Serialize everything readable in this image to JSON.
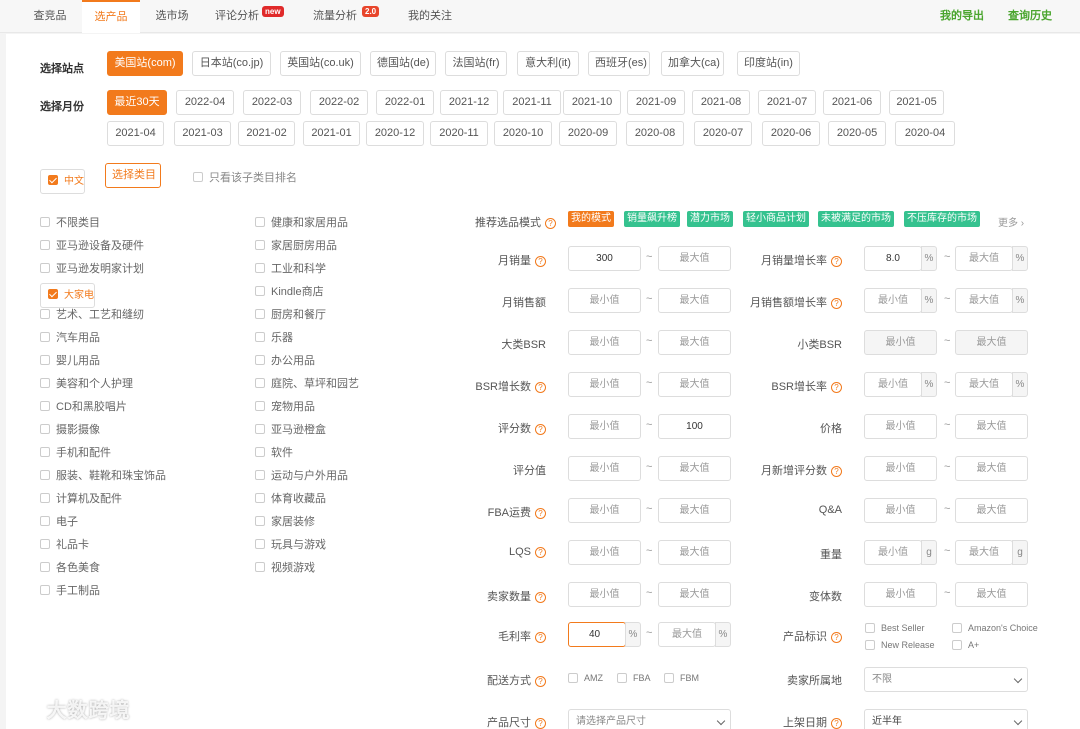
{
  "nav": {
    "tabs": [
      "查竞品",
      "选产品",
      "选市场",
      "评论分析",
      "流量分析",
      "我的关注"
    ],
    "badges": {
      "review": "new",
      "traffic": "2.0"
    },
    "right_links": [
      "我的导出",
      "查询历史"
    ]
  },
  "site": {
    "label": "选择站点",
    "options": [
      "美国站(com)",
      "日本站(co.jp)",
      "英国站(co.uk)",
      "德国站(de)",
      "法国站(fr)",
      "意大利(it)",
      "西班牙(es)",
      "加拿大(ca)",
      "印度站(in)"
    ],
    "selected": "美国站(com)"
  },
  "month": {
    "label": "选择月份",
    "options": [
      "最近30天",
      "2022-04",
      "2022-03",
      "2022-02",
      "2022-01",
      "2021-12",
      "2021-11",
      "2021-10",
      "2021-09",
      "2021-08",
      "2021-07",
      "2021-06",
      "2021-05",
      "2021-04",
      "2021-03",
      "2021-02",
      "2021-01",
      "2020-12",
      "2020-11",
      "2020-10",
      "2020-09",
      "2020-08",
      "2020-07",
      "2020-06",
      "2020-05",
      "2020-04"
    ],
    "selected": "最近30天"
  },
  "lang": {
    "label": "中文",
    "checked": true
  },
  "category_button": "选择类目",
  "only_rank": "只看该子类目排名",
  "categories_left": [
    "不限类目",
    "亚马逊设备及硬件",
    "亚马逊发明家计划",
    "大家电",
    "艺术、工艺和缝纫",
    "汽车用品",
    "婴儿用品",
    "美容和个人护理",
    "CD和黑胶唱片",
    "摄影摄像",
    "手机和配件",
    "服装、鞋靴和珠宝饰品",
    "计算机及配件",
    "电子",
    "礼品卡",
    "各色美食",
    "手工制品"
  ],
  "categories_right": [
    "健康和家居用品",
    "家居厨房用品",
    "工业和科学",
    "Kindle商店",
    "厨房和餐厅",
    "乐器",
    "办公用品",
    "庭院、草坪和园艺",
    "宠物用品",
    "亚马逊橙盒",
    "软件",
    "运动与户外用品",
    "体育收藏品",
    "家居装修",
    "玩具与游戏",
    "视频游戏"
  ],
  "selected_category": "大家电",
  "mode": {
    "label": "推荐选品模式",
    "tags": [
      "我的模式",
      "销量飙升榜",
      "潜力市场",
      "轻小商品计划",
      "未被满足的市场",
      "不压库存的市场"
    ],
    "more": "更多"
  },
  "placeholders": {
    "min": "最小值",
    "max": "最大值"
  },
  "units": {
    "percent": "%",
    "gram": "g"
  },
  "filters": {
    "monthly_sales": {
      "label": "月销量",
      "min": "300"
    },
    "monthly_sales_growth": {
      "label": "月销量增长率",
      "min": "8.0"
    },
    "monthly_revenue": {
      "label": "月销售额"
    },
    "monthly_revenue_growth": {
      "label": "月销售额增长率"
    },
    "main_bsr": {
      "label": "大类BSR"
    },
    "sub_bsr": {
      "label": "小类BSR"
    },
    "bsr_growth": {
      "label": "BSR增长数"
    },
    "bsr_growth_rate": {
      "label": "BSR增长率"
    },
    "rating_count": {
      "label": "评分数",
      "max": "100"
    },
    "price": {
      "label": "价格"
    },
    "rating": {
      "label": "评分值"
    },
    "monthly_new_ratings": {
      "label": "月新增评分数"
    },
    "fba_fee": {
      "label": "FBA运费"
    },
    "qa": {
      "label": "Q&A"
    },
    "lqs": {
      "label": "LQS"
    },
    "weight": {
      "label": "重量"
    },
    "seller_count": {
      "label": "卖家数量"
    },
    "variants": {
      "label": "变体数"
    },
    "margin": {
      "label": "毛利率",
      "min": "40"
    },
    "product_badge": {
      "label": "产品标识",
      "options": [
        "Best Seller",
        "Amazon's Choice",
        "New Release",
        "A+"
      ]
    },
    "shipping": {
      "label": "配送方式",
      "options": [
        "AMZ",
        "FBA",
        "FBM"
      ]
    },
    "seller_location": {
      "label": "卖家所属地",
      "value": "不限"
    },
    "size": {
      "label": "产品尺寸",
      "placeholder": "请选择产品尺寸"
    },
    "listing_date": {
      "label": "上架日期",
      "value": "近半年"
    }
  },
  "watermark": "大数跨境"
}
